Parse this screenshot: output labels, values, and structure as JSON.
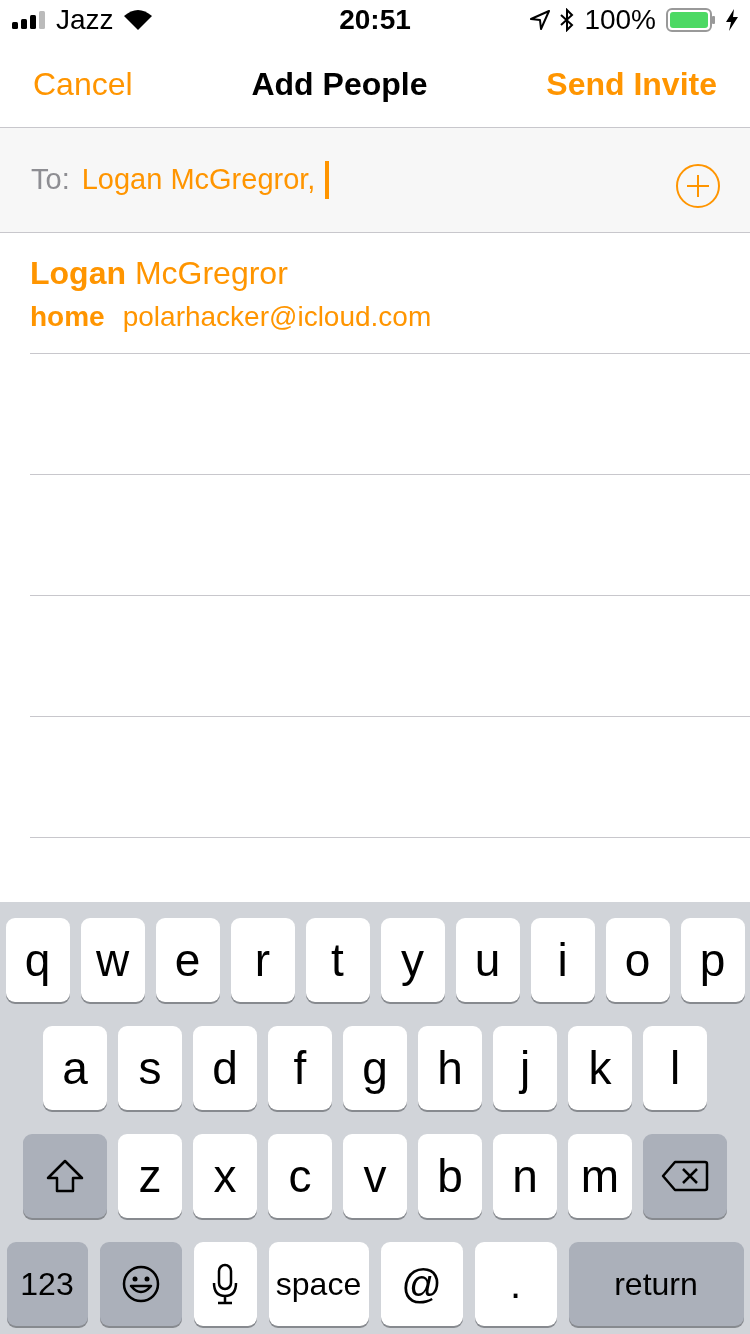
{
  "status_bar": {
    "carrier": "Jazz",
    "time": "20:51",
    "battery": "100%"
  },
  "nav": {
    "cancel": "Cancel",
    "title": "Add People",
    "send": "Send Invite"
  },
  "to_field": {
    "label": "To:",
    "value": "Logan McGregror,"
  },
  "suggestions": [
    {
      "name": "**Logan** McGregror",
      "label": "home",
      "email": "polarhacker@icloud.com"
    }
  ],
  "keyboard": {
    "key_rows": [
      {
        "keys": [
          {
            "kind": "letter",
            "label": "q"
          },
          {
            "kind": "letter",
            "label": "w"
          },
          {
            "kind": "letter",
            "label": "e"
          },
          {
            "kind": "letter",
            "label": "r"
          },
          {
            "kind": "letter",
            "label": "t"
          },
          {
            "kind": "letter",
            "label": "y"
          },
          {
            "kind": "letter",
            "label": "u"
          },
          {
            "kind": "letter",
            "label": "i"
          },
          {
            "kind": "letter",
            "label": "o"
          },
          {
            "kind": "letter",
            "label": "p"
          }
        ]
      },
      {
        "keys": [
          {
            "kind": "letter",
            "label": "a"
          },
          {
            "kind": "letter",
            "label": "s"
          },
          {
            "kind": "letter",
            "label": "d"
          },
          {
            "kind": "letter",
            "label": "f"
          },
          {
            "kind": "letter",
            "label": "g"
          },
          {
            "kind": "letter",
            "label": "h"
          },
          {
            "kind": "letter",
            "label": "j"
          },
          {
            "kind": "letter",
            "label": "k"
          },
          {
            "kind": "letter",
            "label": "l"
          }
        ]
      },
      {
        "keys": [
          {
            "kind": "shift"
          },
          {
            "kind": "letter",
            "label": "z"
          },
          {
            "kind": "letter",
            "label": "x"
          },
          {
            "kind": "letter",
            "label": "c"
          },
          {
            "kind": "letter",
            "label": "v"
          },
          {
            "kind": "letter",
            "label": "b"
          },
          {
            "kind": "letter",
            "label": "n"
          },
          {
            "kind": "letter",
            "label": "m"
          },
          {
            "kind": "delete"
          }
        ]
      },
      {
        "keys": [
          {
            "kind": "mode",
            "label": "123"
          },
          {
            "kind": "emoji"
          },
          {
            "kind": "mic"
          },
          {
            "kind": "space",
            "label": "space"
          },
          {
            "kind": "symbol",
            "label": "@"
          },
          {
            "kind": "symbol",
            "label": "."
          },
          {
            "kind": "return",
            "label": "return"
          }
        ]
      }
    ]
  }
}
